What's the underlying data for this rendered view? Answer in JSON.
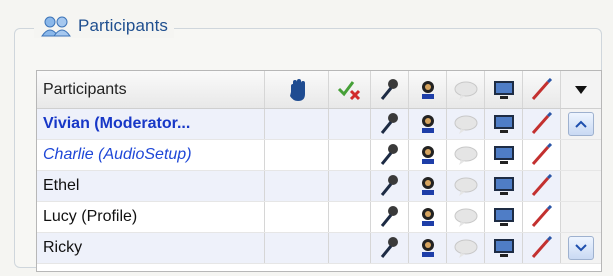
{
  "group_title": "Participants",
  "table": {
    "header_label": "Participants",
    "columns": [
      "name",
      "raise-hand",
      "approve",
      "microphone",
      "camera",
      "chat",
      "screen-share",
      "annotate",
      "menu"
    ],
    "rows": [
      {
        "name": "Vivian (Moderator...",
        "style": "moderator"
      },
      {
        "name": "Charlie (AudioSetup)",
        "style": "audio"
      },
      {
        "name": "Ethel",
        "style": "normal"
      },
      {
        "name": "Lucy (Profile)",
        "style": "normal"
      },
      {
        "name": "Ricky",
        "style": "normal"
      }
    ]
  },
  "icons": {
    "group": "participants-icon",
    "hand": "raise-hand-icon",
    "check": "approve-icon",
    "mic": "microphone-icon",
    "cam": "camera-icon",
    "chat": "chat-icon",
    "screen": "screen-icon",
    "edit": "pen-icon",
    "menu": "menu-arrow-icon"
  },
  "colors": {
    "title": "#1f4f8f",
    "moderator": "#1737c7",
    "audio_setup": "#1e47d7",
    "alt_row": "#eef1fa"
  }
}
